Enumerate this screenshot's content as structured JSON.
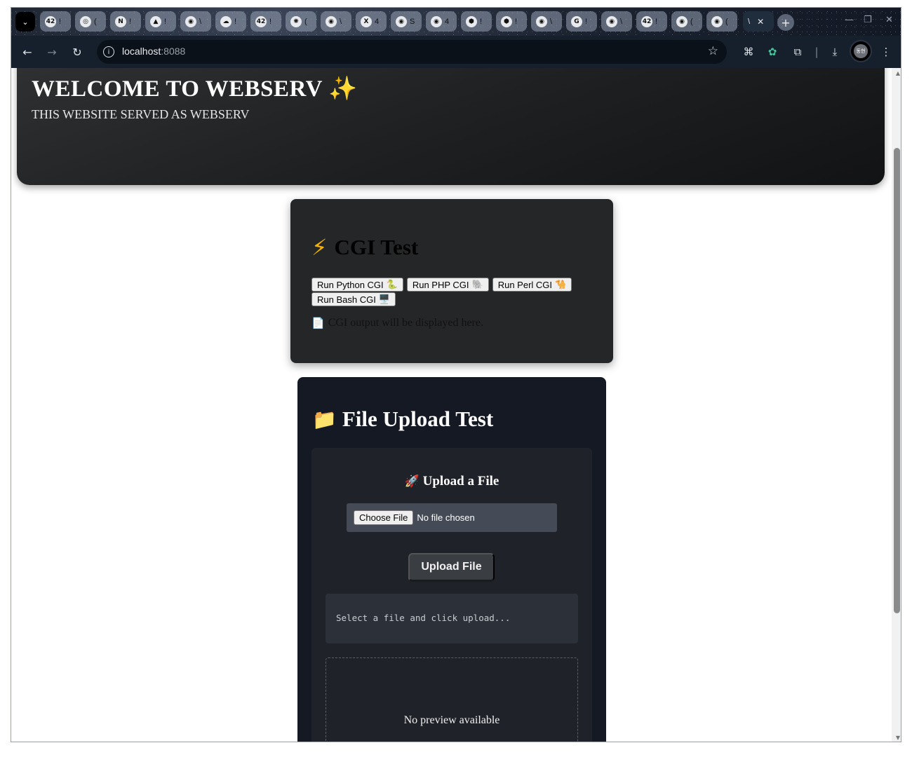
{
  "browser": {
    "tabs": [
      {
        "icon": "42",
        "text": "!"
      },
      {
        "icon": "◎",
        "text": "("
      },
      {
        "icon": "N",
        "text": "!"
      },
      {
        "icon": "▲",
        "text": "!"
      },
      {
        "icon": "◉",
        "text": "\\"
      },
      {
        "icon": "☁",
        "text": "!"
      },
      {
        "icon": "42",
        "text": "!"
      },
      {
        "icon": "✺",
        "text": "("
      },
      {
        "icon": "◉",
        "text": "\\"
      },
      {
        "icon": "X",
        "text": "4"
      },
      {
        "icon": "◉",
        "text": "S"
      },
      {
        "icon": "◉",
        "text": "4"
      },
      {
        "icon": "⬢",
        "text": "!"
      },
      {
        "icon": "⬢",
        "text": "!"
      },
      {
        "icon": "◉",
        "text": "\\"
      },
      {
        "icon": "G",
        "text": "!"
      },
      {
        "icon": "◉",
        "text": "\\"
      },
      {
        "icon": "42",
        "text": "!"
      },
      {
        "icon": "◉",
        "text": "("
      },
      {
        "icon": "◉",
        "text": "("
      }
    ],
    "active_tab": {
      "text": "\\"
    },
    "url_host": "localhost",
    "url_port": ":8088",
    "avatar_text": "동현",
    "ext_badge": "!"
  },
  "hero": {
    "title": "WELCOME TO WEBSERV ✨",
    "subtitle": "THIS WEBSITE SERVED AS WEBSERV"
  },
  "cgi": {
    "icon": "⚡",
    "title": "CGI Test",
    "buttons": [
      {
        "label": "Run Python CGI",
        "emoji": "🐍"
      },
      {
        "label": "Run PHP CGI",
        "emoji": "🐘"
      },
      {
        "label": "Run Perl CGI",
        "emoji": "🐪"
      },
      {
        "label": "Run Bash CGI",
        "emoji": "🖥️"
      }
    ],
    "output_icon": "📄",
    "output": "CGI output will be displayed here."
  },
  "upload": {
    "icon": "📁",
    "title": "File Upload Test",
    "subtitle_icon": "🚀",
    "subtitle": "Upload a File",
    "choose_label": "Choose File",
    "no_file": "No file chosen",
    "upload_button": "Upload File",
    "status": "Select a file and click upload...",
    "preview": "No preview available"
  }
}
